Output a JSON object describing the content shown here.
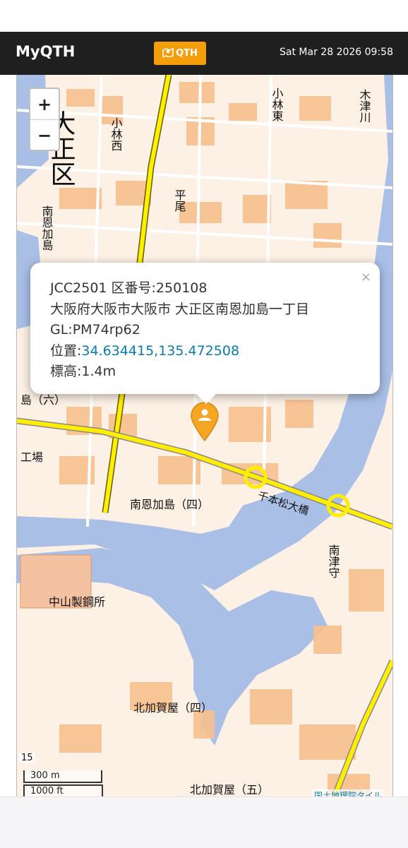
{
  "header": {
    "brand": "MyQTH",
    "qth_button_label": "QTH",
    "datetime": "Sat Mar 28 2026 09:58"
  },
  "map": {
    "zoom_in_label": "+",
    "zoom_out_label": "−",
    "labels": {
      "taisho_ku": "大正区",
      "kobayashi_nishi": "小林西",
      "kobayashi_higashi": "小林東",
      "hirao": "平尾",
      "minami_onkajima": "南恩加島",
      "minami_onkajima_4": "南恩加島（四）",
      "nakayama_steel": "中山製鋼所",
      "kita_kagaya_4": "北加賀屋（四）",
      "kita_kagaya_5": "北加賀屋（五）",
      "senbonmatsu_bridge": "千本松大橋",
      "minami_tsumori": "南津守",
      "kizu_river": "木津川",
      "factory": "工場",
      "kajima_6": "島（六）"
    },
    "zoom_level": "15",
    "scale_metric": "300 m",
    "scale_imperial": "1000 ft",
    "attribution": "国土地理院タイル"
  },
  "popup": {
    "close_label": "×",
    "jcc_line": "JCC2501 区番号:250108",
    "address": "大阪府大阪市大阪市 大正区南恩加島一丁目",
    "grid_line": "GL:PM74rp62",
    "position_label": "位置:",
    "coordinates": "34.634415,135.472508",
    "elevation": "標高:1.4m"
  },
  "colors": {
    "navbar_bg": "#1f1f1f",
    "accent": "#f59e0b",
    "link": "#0a7bb0",
    "water": "#a9bfe6",
    "road_major": "#ffee00",
    "building": "#f7c08e"
  },
  "icons": {
    "qth_icon": "map-marker-person-icon",
    "marker": "map-pin-person-icon"
  }
}
